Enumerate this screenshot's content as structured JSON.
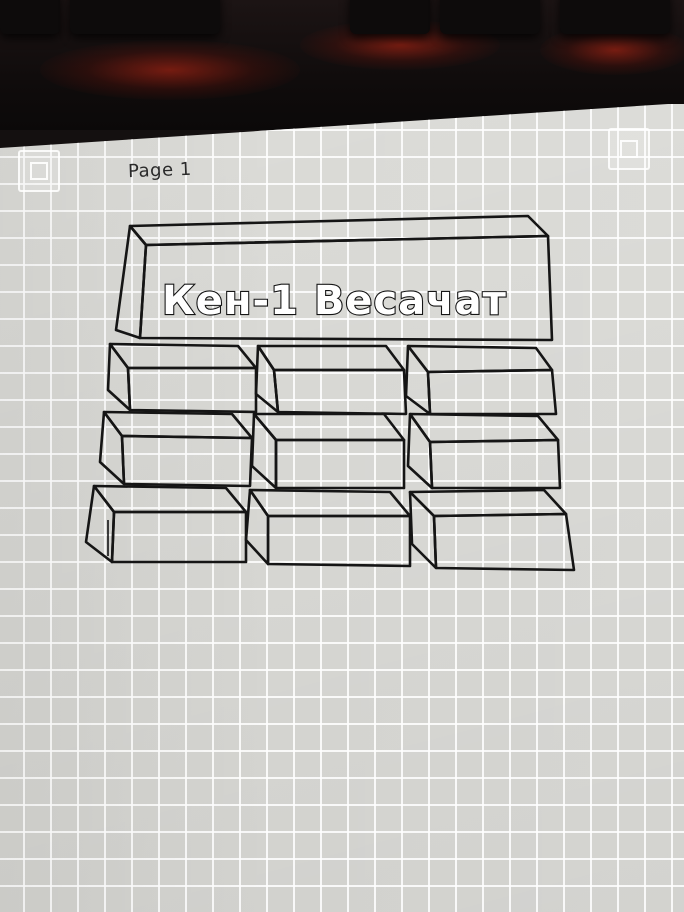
{
  "page_label": "Page 1",
  "banner_title": "Кен-1 Весачат",
  "colors": {
    "paper": "#dcdcd8",
    "grid": "#ffffff",
    "ink": "#151515",
    "background": "#141010"
  }
}
